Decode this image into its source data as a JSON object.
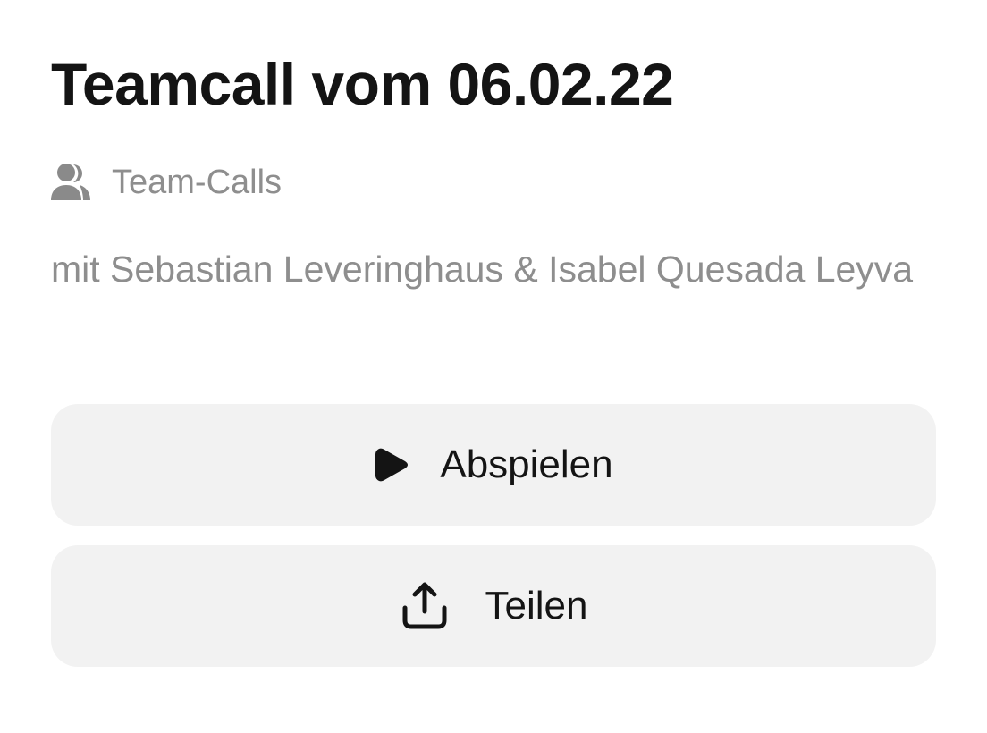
{
  "title": "Teamcall vom 06.02.22",
  "category": {
    "icon": "people-icon",
    "label": "Team-Calls"
  },
  "participants": "mit Sebastian Leveringhaus & Isabel Quesada Leyva",
  "actions": {
    "play": {
      "icon": "play-icon",
      "label": "Abspielen"
    },
    "share": {
      "icon": "share-icon",
      "label": "Teilen"
    }
  },
  "colors": {
    "text_primary": "#141414",
    "text_secondary": "#8e8e8e",
    "button_bg": "#f2f2f2",
    "icon_secondary": "#8a8a8a"
  }
}
